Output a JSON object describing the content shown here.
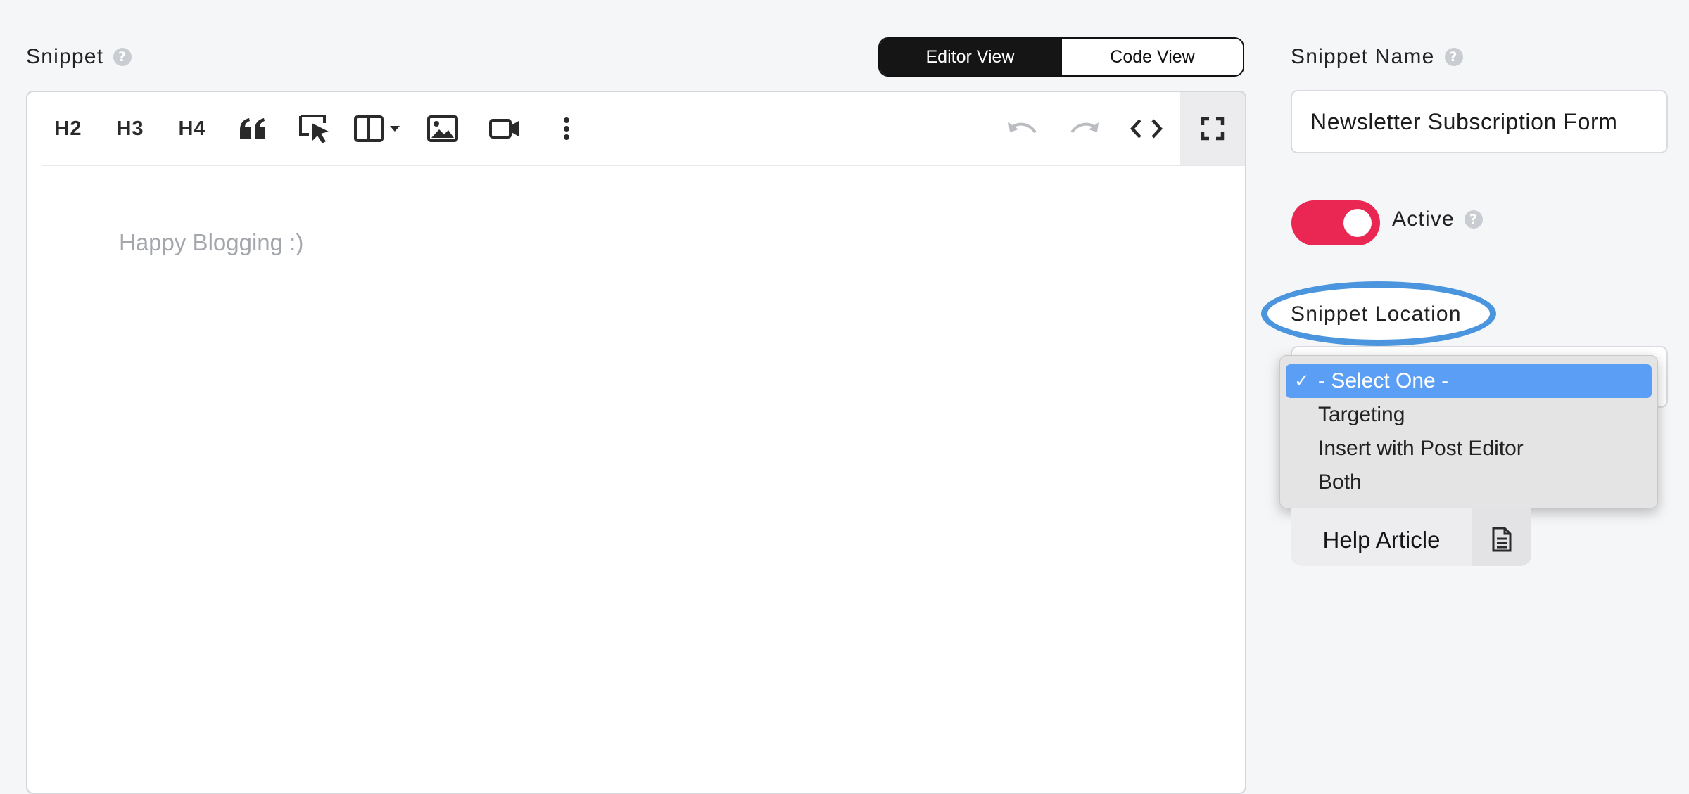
{
  "snippet": {
    "label": "Snippet",
    "help_icon": "question-circle-icon"
  },
  "view_toggle": {
    "editor_view": "Editor View",
    "code_view": "Code View",
    "active": "editor_view"
  },
  "toolbar": {
    "h2": "H2",
    "h3": "H3",
    "h4": "H4",
    "icons": [
      "quote-icon",
      "select-pointer-icon",
      "columns-icon",
      "image-icon",
      "video-icon",
      "more-vertical-icon",
      "undo-icon",
      "redo-icon",
      "code-icon",
      "fullscreen-icon"
    ]
  },
  "editor": {
    "placeholder": "Happy Blogging :)"
  },
  "snippet_name": {
    "label": "Snippet Name",
    "value": "Newsletter Subscription Form"
  },
  "active": {
    "label": "Active",
    "enabled": true
  },
  "snippet_location": {
    "label": "Snippet Location",
    "selected": "- Select One -",
    "options": [
      "- Select One -",
      "Targeting",
      "Insert with Post Editor",
      "Both"
    ]
  },
  "help_article": {
    "label": "Help Article",
    "icon": "document-icon"
  },
  "colors": {
    "toggle_active": "#ea2753",
    "highlight_ring": "#4a95de",
    "selected_option": "#5a9ef5"
  }
}
